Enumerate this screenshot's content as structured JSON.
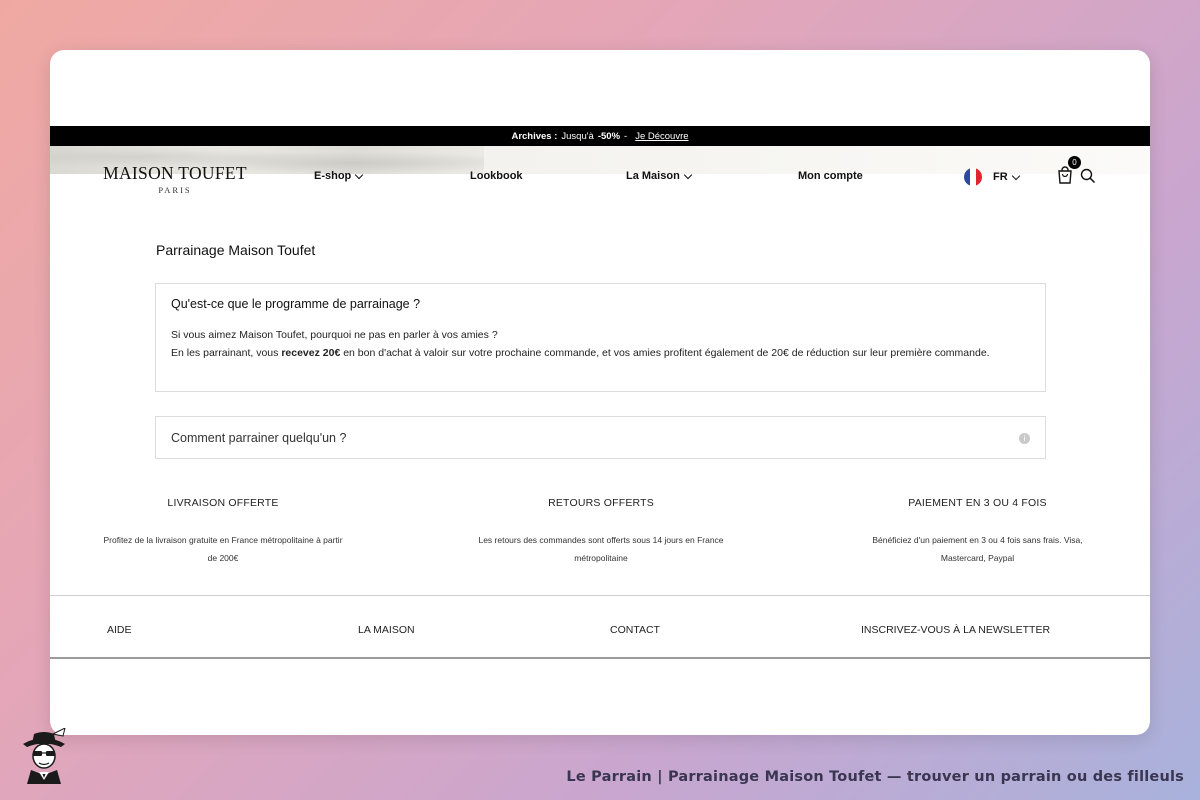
{
  "topbar": {
    "label": "Archives :",
    "text": "Jusqu'à",
    "discount": "-50%",
    "separator": "-",
    "link": "Je Découvre"
  },
  "header": {
    "logo_brand": "MAISON TOUFET",
    "logo_city": "PARIS",
    "nav": [
      {
        "label": "E-shop",
        "has_dropdown": true
      },
      {
        "label": "Lookbook",
        "has_dropdown": false
      },
      {
        "label": "La Maison",
        "has_dropdown": true
      },
      {
        "label": "Mon compte",
        "has_dropdown": false
      }
    ],
    "language": "FR",
    "cart_count": "0",
    "flag_colors": [
      "#2b4aa0",
      "#ffffff",
      "#e1252f"
    ]
  },
  "main": {
    "title": "Parrainage Maison Toufet",
    "faq1": {
      "question": "Qu'est-ce que le programme de parrainage ?",
      "line1": "Si vous aimez Maison Toufet, pourquoi ne pas en parler à vos amies ?",
      "line2_before": "En les parrainant, vous ",
      "line2_bold": "recevez 20€",
      "line2_after": " en bon d'achat à valoir sur votre prochaine commande, et vos amies profitent également de 20€ de réduction sur leur première commande."
    },
    "faq2": {
      "question": "Comment parrainer quelqu'un ?"
    }
  },
  "features": [
    {
      "title": "LIVRAISON OFFERTE",
      "desc": "Profitez de la livraison gratuite en France métropolitaine à partir de 200€"
    },
    {
      "title": "RETOURS OFFERTS",
      "desc": "Les retours des commandes sont offerts sous 14 jours en France métropolitaine"
    },
    {
      "title": "PAIEMENT EN 3 OU 4 FOIS",
      "desc": "Bénéficiez d'un paiement en 3 ou 4 fois sans frais. Visa, Mastercard, Paypal"
    }
  ],
  "footer": {
    "items": [
      "AIDE",
      "LA MAISON",
      "CONTACT",
      "INSCRIVEZ-VOUS À LA NEWSLETTER"
    ]
  },
  "caption": "Le Parrain | Parrainage Maison Toufet — trouver un parrain ou des filleuls"
}
